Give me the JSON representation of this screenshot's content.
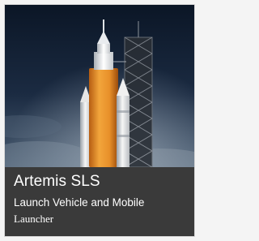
{
  "card": {
    "title": "Artemis SLS",
    "subtitle_line1": "Launch Vehicle and Mobile",
    "subtitle_line2": "Launcher"
  },
  "colors": {
    "caption_background": "#3a3a3a",
    "caption_text": "#ffffff",
    "sky_top": "#0b1626",
    "sky_bottom": "#4a5d72",
    "core_stage_orange": "#e8902a",
    "booster_white": "#f2f2f2"
  },
  "icons": [
    "sls-rocket-image"
  ]
}
